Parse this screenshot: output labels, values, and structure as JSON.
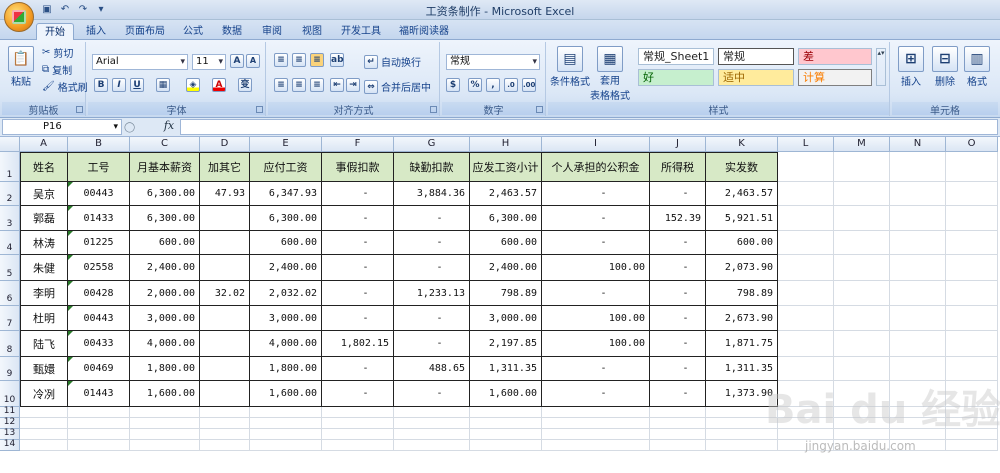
{
  "window": {
    "title": "工资条制作 - Microsoft Excel"
  },
  "qat": {
    "icons": [
      "save-icon",
      "undo-icon",
      "redo-icon",
      "customize-icon"
    ]
  },
  "tabs": [
    "开始",
    "插入",
    "页面布局",
    "公式",
    "数据",
    "审阅",
    "视图",
    "开发工具",
    "福昕阅读器"
  ],
  "active_tab": "开始",
  "ribbon": {
    "clipboard": {
      "label": "剪贴板",
      "paste": "粘贴",
      "cut": "剪切",
      "copy": "复制",
      "format_painter": "格式刷"
    },
    "font": {
      "label": "字体",
      "font_name": "Arial",
      "font_size": "11",
      "grow": "A",
      "shrink": "A",
      "bold": "B",
      "italic": "I",
      "underline": "U",
      "phonetic": "变"
    },
    "alignment": {
      "label": "对齐方式",
      "wrap": "自动换行",
      "merge": "合并后居中"
    },
    "number": {
      "label": "数字",
      "format": "常规",
      "percent": "%",
      "comma": ","
    },
    "styles": {
      "label": "样式",
      "conditional": "条件格式",
      "table_format_1": "套用",
      "table_format_2": "表格格式",
      "normal_sheet1": "常规_Sheet1",
      "normal": "常规",
      "bad": "差",
      "good": "好",
      "neutral": "适中",
      "calculation": "计算"
    },
    "cells": {
      "label": "单元格",
      "insert": "插入",
      "delete": "删除",
      "format": "格式"
    }
  },
  "formula_bar": {
    "name_box": "P16",
    "fx": "fx",
    "formula": ""
  },
  "columns": [
    "A",
    "B",
    "C",
    "D",
    "E",
    "F",
    "G",
    "H",
    "I",
    "J",
    "K",
    "L",
    "M",
    "N",
    "O"
  ],
  "rows": [
    "1",
    "2",
    "3",
    "4",
    "5",
    "6",
    "7",
    "8",
    "9",
    "10",
    "11",
    "12",
    "13",
    "14"
  ],
  "table": {
    "headers": [
      "姓名",
      "工号",
      "月基本薪资",
      "加其它",
      "应付工资",
      "事假扣款",
      "缺勤扣款",
      "应发工资小计",
      "个人承担的公积金",
      "所得税",
      "实发数"
    ],
    "rows": [
      [
        "吴京",
        "00443",
        "6,300.00",
        "47.93",
        "6,347.93",
        "-",
        "3,884.36",
        "2,463.57",
        "-",
        "-",
        "2,463.57"
      ],
      [
        "郭磊",
        "01433",
        "6,300.00",
        "",
        "6,300.00",
        "-",
        "-",
        "6,300.00",
        "-",
        "152.39",
        "5,921.51"
      ],
      [
        "林涛",
        "01225",
        "600.00",
        "",
        "600.00",
        "-",
        "-",
        "600.00",
        "-",
        "-",
        "600.00"
      ],
      [
        "朱健",
        "02558",
        "2,400.00",
        "",
        "2,400.00",
        "-",
        "-",
        "2,400.00",
        "100.00",
        "-",
        "2,073.90"
      ],
      [
        "李明",
        "00428",
        "2,000.00",
        "32.02",
        "2,032.02",
        "-",
        "1,233.13",
        "798.89",
        "-",
        "-",
        "798.89"
      ],
      [
        "杜明",
        "00443",
        "3,000.00",
        "",
        "3,000.00",
        "-",
        "-",
        "3,000.00",
        "100.00",
        "-",
        "2,673.90"
      ],
      [
        "陆飞",
        "00433",
        "4,000.00",
        "",
        "4,000.00",
        "1,802.15",
        "-",
        "2,197.85",
        "100.00",
        "-",
        "1,871.75"
      ],
      [
        "甄嬛",
        "00469",
        "1,800.00",
        "",
        "1,800.00",
        "-",
        "488.65",
        "1,311.35",
        "-",
        "-",
        "1,311.35"
      ],
      [
        "冷冽",
        "01443",
        "1,600.00",
        "",
        "1,600.00",
        "-",
        "-",
        "1,600.00",
        "-",
        "-",
        "1,373.90"
      ]
    ]
  },
  "watermark": {
    "text": "Bai du 经验",
    "url": "jingyan.baidu.com"
  }
}
